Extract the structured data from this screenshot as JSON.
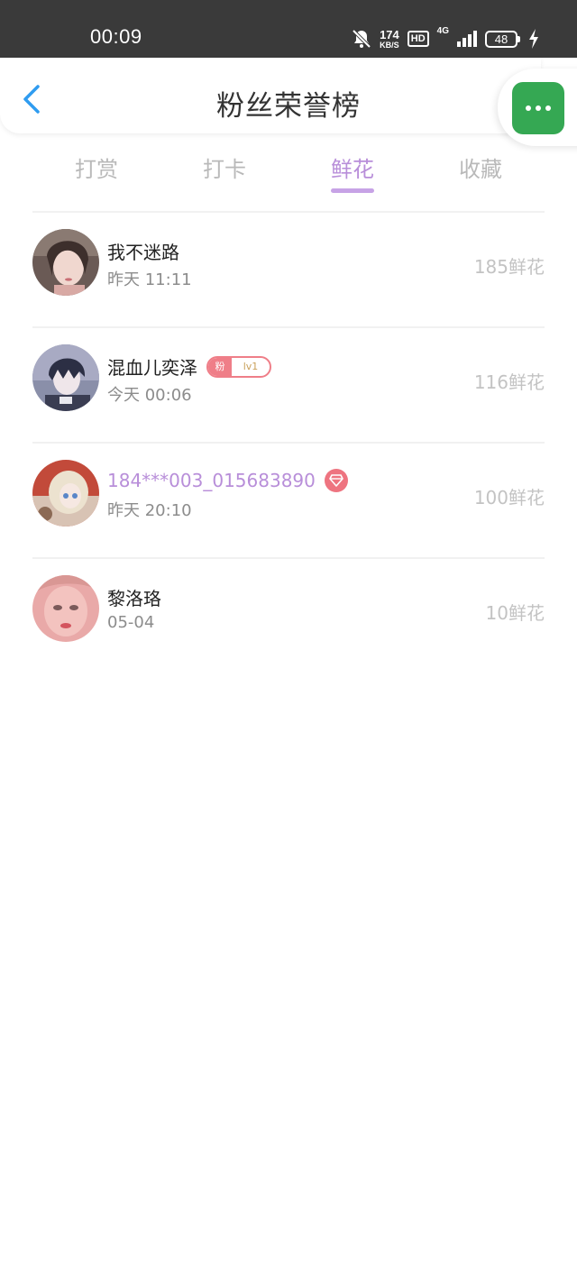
{
  "status_bar": {
    "time": "00:09",
    "net_speed_value": "174",
    "net_speed_unit": "KB/S",
    "hd_label": "HD",
    "network_type": "4G",
    "battery_level": "48"
  },
  "header": {
    "title": "粉丝荣誉榜",
    "back_icon": "chevron-left-icon",
    "more_icon": "more-dots-icon"
  },
  "tabs": [
    {
      "label": "打赏",
      "active": false
    },
    {
      "label": "打卡",
      "active": false
    },
    {
      "label": "鲜花",
      "active": true
    },
    {
      "label": "收藏",
      "active": false
    }
  ],
  "list": [
    {
      "name": "我不迷路",
      "time": "昨天 11:11",
      "amount": "185鲜花",
      "badge": null
    },
    {
      "name": "混血儿奕泽",
      "time": "今天 00:06",
      "amount": "116鲜花",
      "badge": {
        "label": "粉",
        "level": "lv1"
      }
    },
    {
      "name": "184***003_015683890",
      "time": "昨天 20:10",
      "amount": "100鲜花",
      "badge": "diamond-icon"
    },
    {
      "name": "黎洛珞",
      "time": "05-04",
      "amount": "10鲜花",
      "badge": null
    }
  ],
  "colors": {
    "status_bar_bg": "#3a3a3a",
    "accent_purple": "#b88ed9",
    "back_arrow_blue": "#2f9cf0",
    "more_button_green": "#35a853",
    "fan_badge_pink": "#ef7e88",
    "gem_badge_pink": "#ee7480",
    "muted_text": "#c3c3c3"
  }
}
